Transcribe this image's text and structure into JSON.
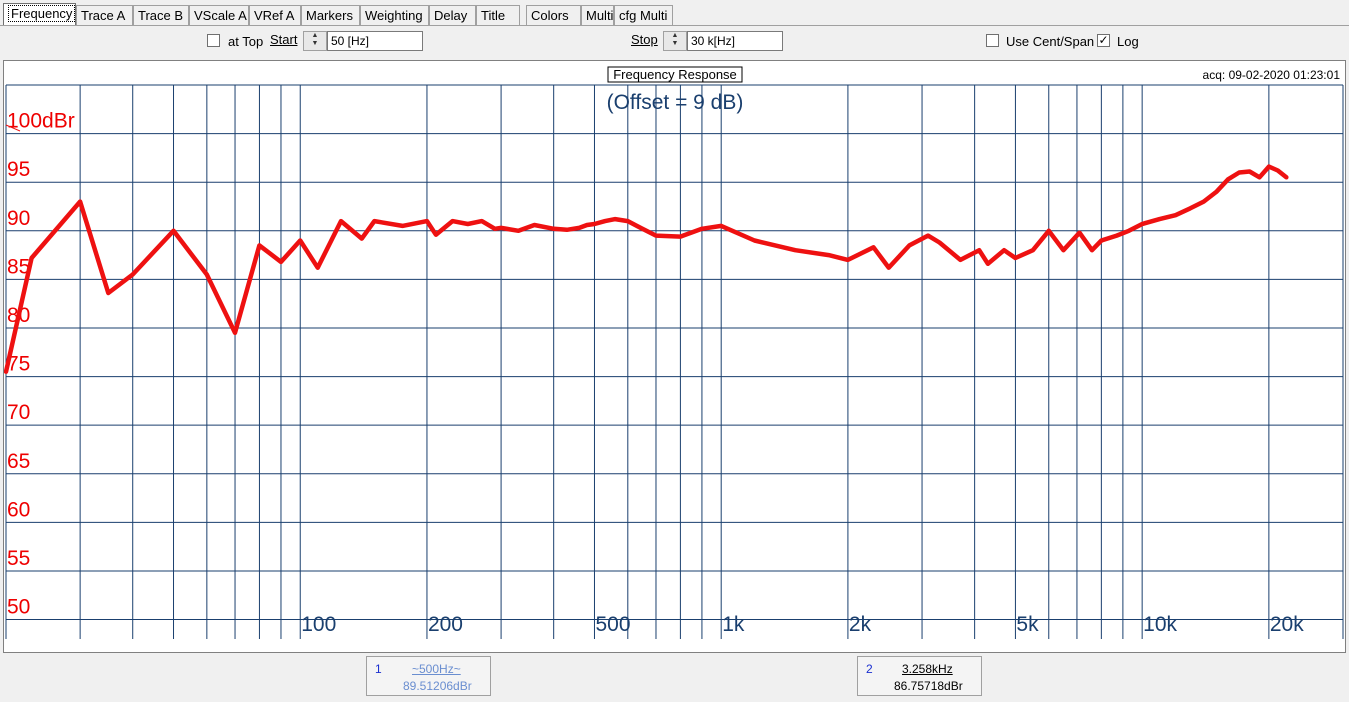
{
  "tabs": [
    "Frequency",
    "Trace A",
    "Trace B",
    "VScale A",
    "VRef A",
    "Markers",
    "Weighting",
    "Delay",
    "Title",
    "Colors",
    "Multi",
    "cfg Multi"
  ],
  "active_tab": "Frequency",
  "controls": {
    "at_top_label": "at Top",
    "at_top_checked": false,
    "start_label": "Start",
    "start_value": "50 [Hz]",
    "stop_label": "Stop",
    "stop_value": "30 k[Hz]",
    "use_cent_span_label": "Use Cent/Span",
    "use_cent_span_checked": false,
    "log_label": "Log",
    "log_checked": true,
    "check_mark": "✓",
    "spin_up": "▲",
    "spin_down": "▼"
  },
  "chart_header": {
    "title": "Frequency Response",
    "acq": "acq: 09-02-2020 01:23:01"
  },
  "markers": [
    {
      "index": "1",
      "freq": "~500Hz~",
      "value": "89.51206dBr"
    },
    {
      "index": "2",
      "freq": "3.258kHz",
      "value": "86.75718dBr"
    }
  ],
  "colors": {
    "trace": "#ee1111",
    "grid": "#1a3f6e",
    "ylabels": "#ee0000",
    "xlabels": "#1a3f6e",
    "offset_text": "#1a3f6e"
  },
  "chart_data": {
    "type": "line",
    "title": "Frequency Response",
    "annotation": "(Offset = 9 dB)",
    "ylabel_unit": "dBr",
    "x_scale": "log",
    "xlim": [
      20,
      30000
    ],
    "ylim": [
      48,
      105
    ],
    "yticks": [
      50,
      55,
      60,
      65,
      70,
      75,
      80,
      85,
      90,
      95,
      100
    ],
    "ytick_labels": [
      "50",
      "55",
      "60",
      "65",
      "70",
      "75",
      "80",
      "85",
      "90",
      "95",
      "100dBr"
    ],
    "xticks": [
      100,
      200,
      500,
      1000,
      2000,
      5000,
      10000,
      20000
    ],
    "xtick_labels": [
      "100",
      "200",
      "500",
      "1k",
      "2k",
      "5k",
      "10k",
      "20k"
    ],
    "grid": true,
    "series": [
      {
        "x": [
          20,
          23,
          30,
          35,
          40,
          50,
          60,
          70,
          80,
          90,
          100,
          110,
          125,
          140,
          150,
          175,
          200,
          210,
          230,
          250,
          270,
          290,
          300,
          330,
          360,
          400,
          430,
          460,
          480,
          500,
          530,
          560,
          600,
          650,
          700,
          800,
          900,
          1000,
          1200,
          1500,
          1800,
          2000,
          2300,
          2500,
          2800,
          3100,
          3300,
          3700,
          4100,
          4300,
          4700,
          5000,
          5500,
          6000,
          6500,
          7100,
          7600,
          8000,
          8700,
          9300,
          10000,
          11000,
          12000,
          13000,
          14000,
          15000,
          16000,
          17000,
          18000,
          19000,
          20000,
          21000,
          22000
        ],
        "y": [
          75.5,
          87.2,
          93.0,
          83.6,
          85.5,
          90.0,
          85.5,
          79.5,
          88.5,
          86.8,
          89.0,
          86.2,
          91.0,
          89.2,
          91.0,
          90.5,
          91.0,
          89.6,
          91.0,
          90.7,
          91.0,
          90.2,
          90.3,
          90.0,
          90.6,
          90.2,
          90.1,
          90.3,
          90.6,
          90.7,
          91.0,
          91.2,
          91.0,
          90.2,
          89.5,
          89.4,
          90.2,
          90.5,
          89.0,
          88.0,
          87.5,
          87.0,
          88.3,
          86.2,
          88.5,
          89.5,
          88.8,
          87.0,
          88.0,
          86.6,
          88.0,
          87.2,
          88.0,
          90.0,
          88.0,
          89.8,
          88.0,
          89.0,
          89.5,
          90.0,
          90.7,
          91.2,
          91.6,
          92.3,
          93.0,
          94.0,
          95.3,
          96.0,
          96.1,
          95.5,
          96.6,
          96.2,
          95.5
        ]
      }
    ]
  }
}
